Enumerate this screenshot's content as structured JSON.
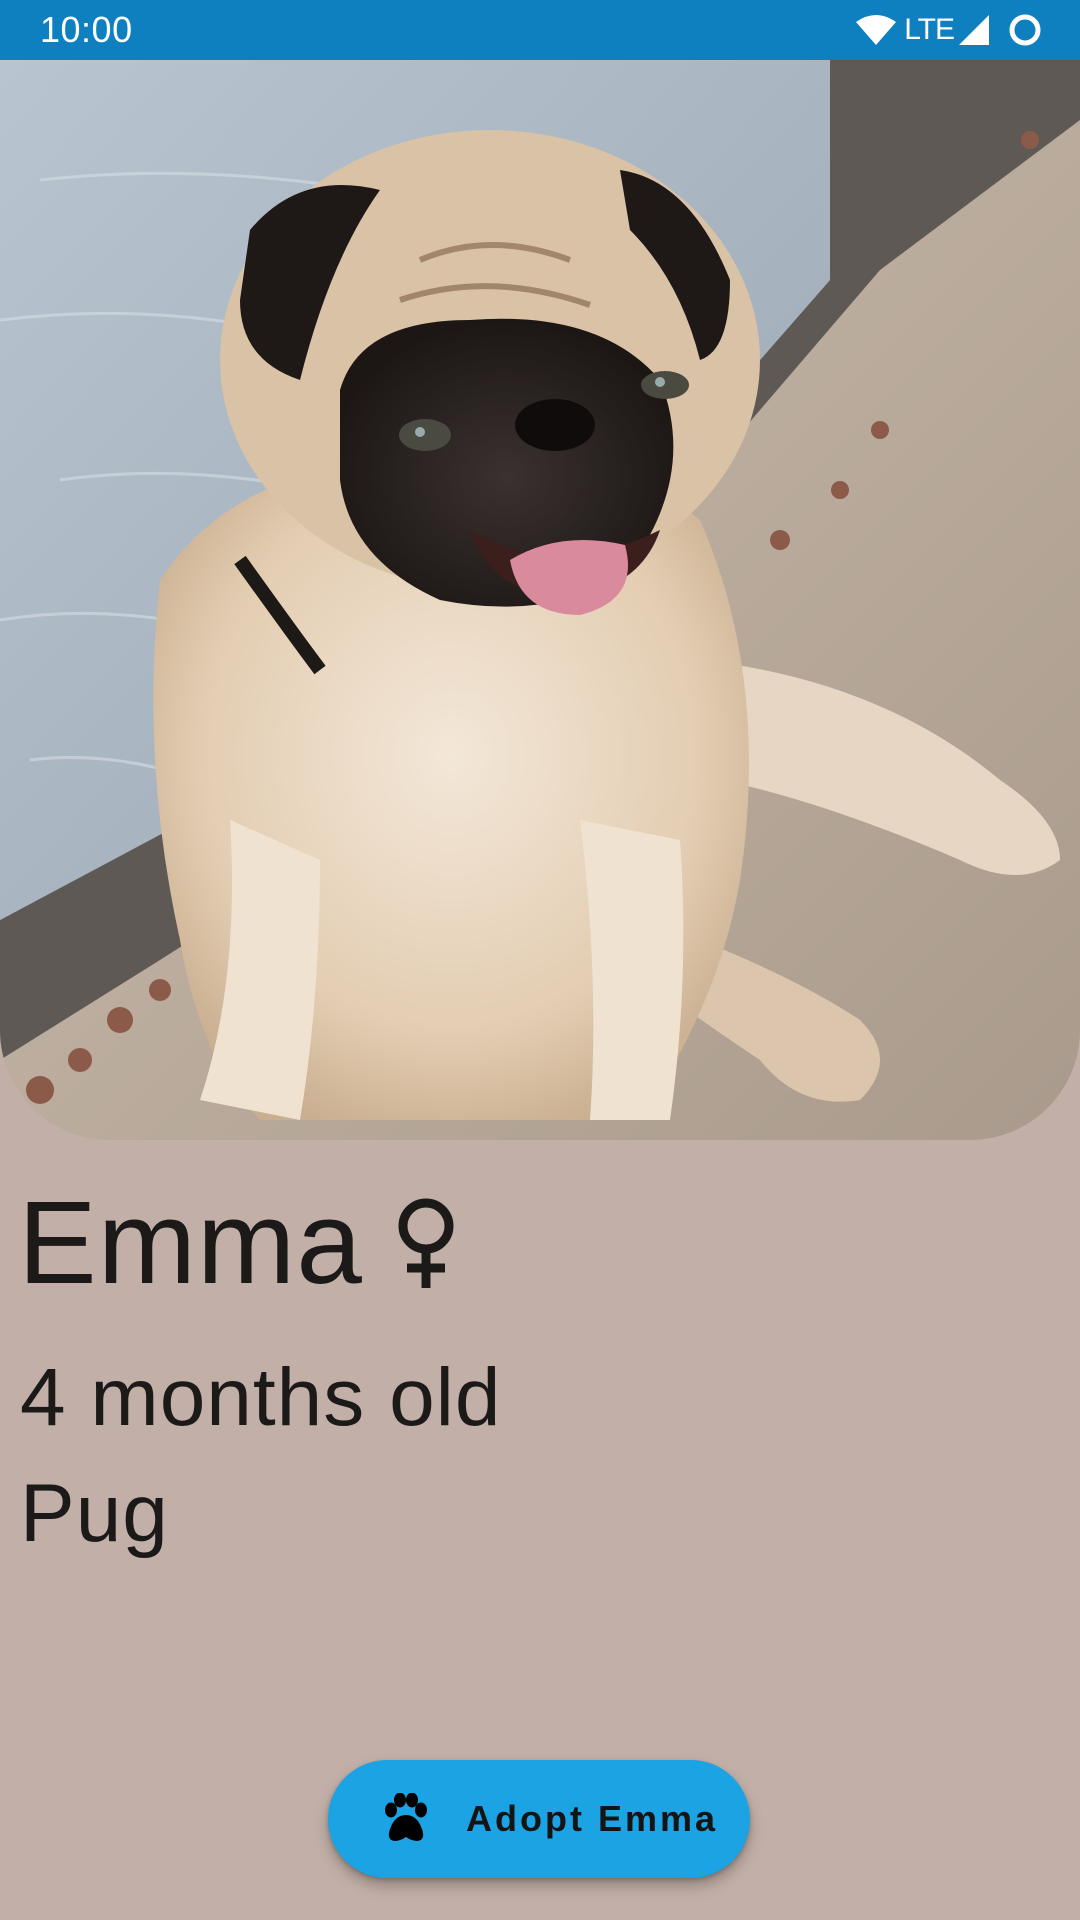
{
  "status_bar": {
    "time": "10:00",
    "network_label": "LTE",
    "icons": [
      "wifi-icon",
      "cellular-signal-icon",
      "battery-ring-icon"
    ]
  },
  "hero_image": {
    "subject": "pug photo",
    "icon": "pug-photo"
  },
  "pet": {
    "name": "Emma",
    "gender_symbol": "♀",
    "gender_icon": "female-icon",
    "age": "4 months old",
    "breed": "Pug"
  },
  "adopt_button": {
    "label": "Adopt Emma",
    "icon": "paw-icon"
  },
  "colors": {
    "status_bar": "#0e7fbf",
    "background": "#c2b0a8",
    "button": "#1ba3e3",
    "text": "#1b1a19"
  }
}
